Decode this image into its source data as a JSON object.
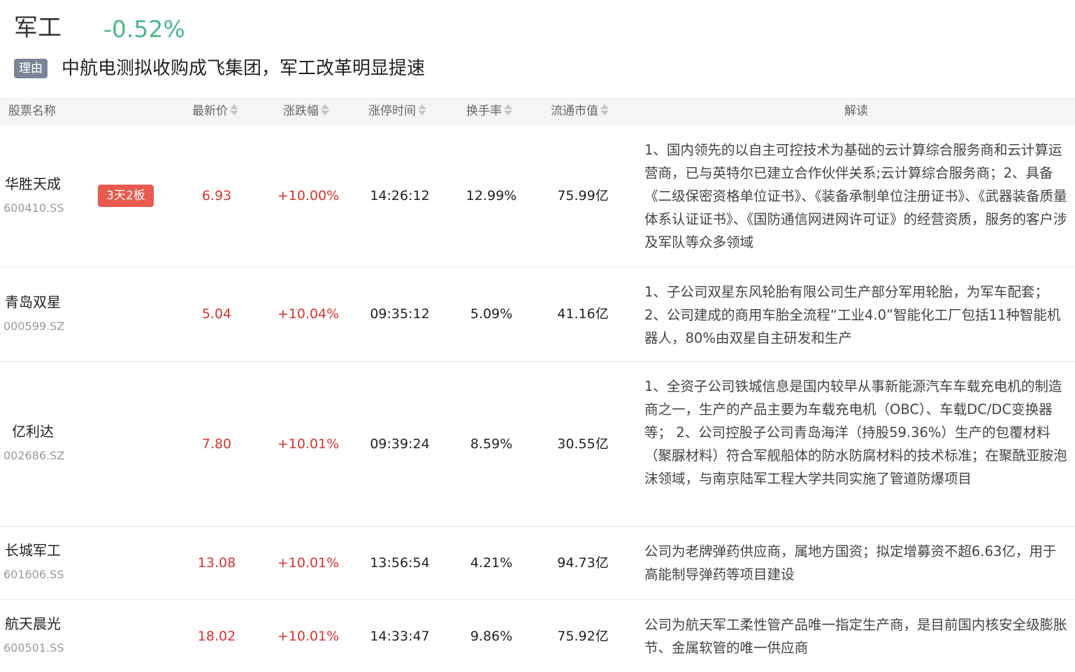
{
  "header": {
    "sector": "军工",
    "change": "-0.52%",
    "reason_tag": "理由",
    "reason": "中航电测拟收购成飞集团，军工改革明显提速"
  },
  "columns": {
    "name": "股票名称",
    "price": "最新价",
    "change": "涨跌幅",
    "limit_time": "涨停时间",
    "turnover": "换手率",
    "market_cap": "流通市值",
    "interpretation": "解读"
  },
  "rows": [
    {
      "name": "华胜天成",
      "code": "600410.SS",
      "badge": "3天2板",
      "price": "6.93",
      "change": "+10.00%",
      "time": "14:26:12",
      "turnover": "12.99%",
      "market_cap": "75.99亿",
      "interpretation": "1、国内领先的以自主可控技术为基础的云计算综合服务商和云计算运营商，已与英特尔已建立合作伙伴关系;云计算综合服务商；2、具备《二级保密资格单位证书》、《装备承制单位注册证书》、《武器装备质量体系认证证书》、《国防通信网进网许可证》的经营资质，服务的客户涉及军队等众多领域"
    },
    {
      "name": "青岛双星",
      "code": "000599.SZ",
      "badge": "",
      "price": "5.04",
      "change": "+10.04%",
      "time": "09:35:12",
      "turnover": "5.09%",
      "market_cap": "41.16亿",
      "interpretation": "1、子公司双星东风轮胎有限公司生产部分军用轮胎，为军车配套； 2、公司建成的商用车胎全流程“工业4.0”智能化工厂包括11种智能机器人，80%由双星自主研发和生产"
    },
    {
      "name": "亿利达",
      "code": "002686.SZ",
      "badge": "",
      "price": "7.80",
      "change": "+10.01%",
      "time": "09:39:24",
      "turnover": "8.59%",
      "market_cap": "30.55亿",
      "interpretation": "1、全资子公司铁城信息是国内较早从事新能源汽车车载充电机的制造商之一，生产的产品主要为车载充电机（OBC）、车载DC/DC变换器等； 2、公司控股子公司青岛海洋（持股59.36%）生产的包覆材料（聚脲材料）符合军舰船体的防水防腐材料的技术标准；在聚酰亚胺泡沫领域，与南京陆军工程大学共同实施了管道防爆项目"
    },
    {
      "name": "长城军工",
      "code": "601606.SS",
      "badge": "",
      "price": "13.08",
      "change": "+10.01%",
      "time": "13:56:54",
      "turnover": "4.21%",
      "market_cap": "94.73亿",
      "interpretation": "公司为老牌弹药供应商，属地方国资；拟定增募资不超6.63亿，用于高能制导弹药等项目建设"
    },
    {
      "name": "航天晨光",
      "code": "600501.SS",
      "badge": "",
      "price": "18.02",
      "change": "+10.01%",
      "time": "14:33:47",
      "turnover": "9.86%",
      "market_cap": "75.92亿",
      "interpretation": "公司为航天军工柔性管产品唯一指定生产商，是目前国内核安全级膨胀节、金属软管的唯一供应商"
    }
  ],
  "colors": {
    "up": "#d7342e",
    "down": "#4cb88a",
    "badge": "#e85a4f",
    "reason_tag": "#7c8596"
  }
}
